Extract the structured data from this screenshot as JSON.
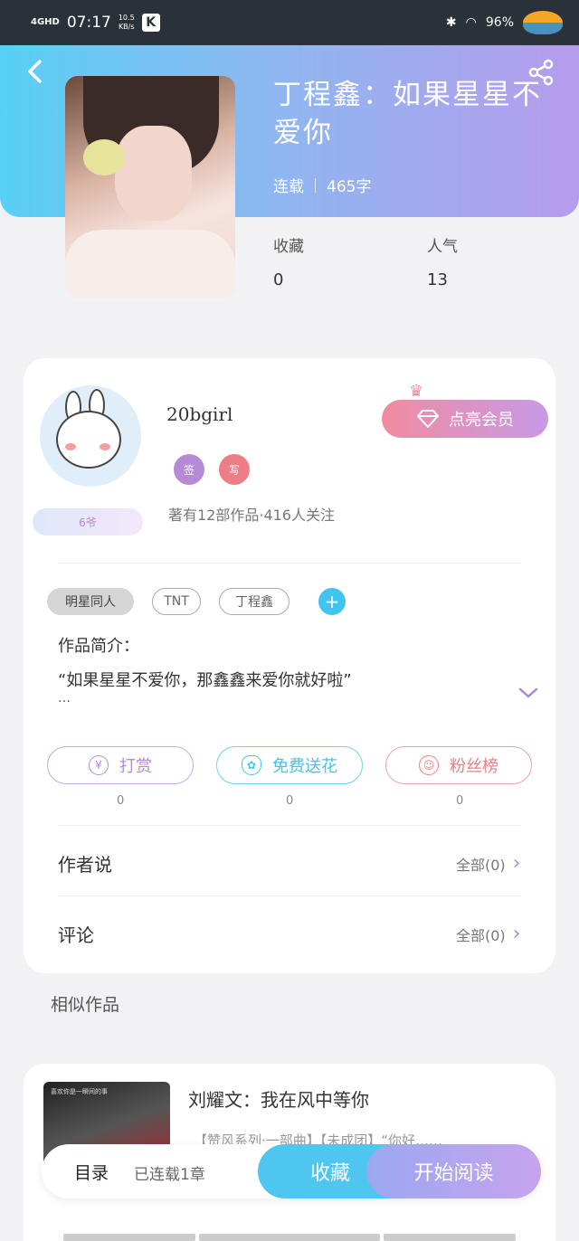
{
  "status_bar": {
    "network": "4GHD",
    "time": "07:17",
    "speed": "10.5",
    "speed_unit": "KB/s",
    "app_badge": "K",
    "battery": "96%"
  },
  "book": {
    "title": "丁程鑫：如果星星不爱你",
    "status": "连载",
    "word_count": "465字",
    "stats": [
      {
        "label": "收藏",
        "value": "0"
      },
      {
        "label": "人气",
        "value": "13"
      }
    ]
  },
  "author": {
    "name": "20bgirl",
    "level": "6爷",
    "badges": [
      "签",
      "写"
    ],
    "summary": "著有12部作品·416人关注",
    "vip_button": "点亮会员"
  },
  "tags": [
    "明星同人",
    "TNT",
    "丁程鑫"
  ],
  "intro": {
    "label": "作品简介：",
    "text": "“如果星星不爱你，那鑫鑫来爱你就好啦”",
    "more": "…"
  },
  "actions": [
    {
      "label": "打赏",
      "count": "0",
      "icon": "yen-icon",
      "color": "#b68ad6"
    },
    {
      "label": "免费送花",
      "count": "0",
      "icon": "flower-icon",
      "color": "#41c4ef"
    },
    {
      "label": "粉丝榜",
      "count": "0",
      "icon": "user-icon",
      "color": "#ee7d86"
    }
  ],
  "rows": [
    {
      "label": "作者说",
      "right": "全部(0)"
    },
    {
      "label": "评论",
      "right": "全部(0)"
    }
  ],
  "similar": {
    "section_title": "相似作品",
    "items": [
      {
        "title": "刘耀文：我在风中等你",
        "desc": "【赞风系列·一部曲】【未成团】“你好……",
        "cover_text": "喜欢你是一瞬间的事"
      }
    ]
  },
  "bottom_bar": {
    "toc_label": "目录",
    "toc_status": "已连载1章",
    "collect": "收藏",
    "read": "开始阅读"
  },
  "colors": {
    "header_start": "#58d0f5",
    "header_end": "#b69cec",
    "accent_blue": "#41c4ef",
    "accent_purple": "#b68ad6",
    "accent_pink": "#ee7d86"
  }
}
